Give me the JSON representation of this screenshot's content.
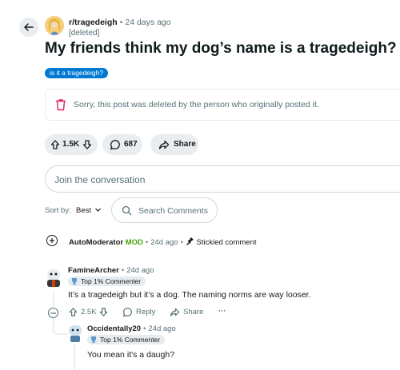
{
  "post": {
    "subreddit": "r/tragedeigh",
    "time": "24 days ago",
    "author": "[deleted]",
    "title": "My friends think my dog’s name is a tragedeigh?",
    "flair": "is it a tragedeigh?",
    "deleted_message": "Sorry, this post was deleted by the person who originally posted it."
  },
  "actions": {
    "votes": "1.5K",
    "comments": "687",
    "share": "Share"
  },
  "join_placeholder": "Join the conversation",
  "sort": {
    "label": "Sort by:",
    "value": "Best",
    "search_placeholder": "Search Comments"
  },
  "automod": {
    "name": "AutoModerator",
    "mod_badge": "MOD",
    "time": "24d ago",
    "stickied": "Stickied comment"
  },
  "comments": [
    {
      "author": "FamineArcher",
      "time": "24d ago",
      "badge": "Top 1% Commenter",
      "text": "It’s a tragedeigh but it’s a dog. The naming norms are way looser.",
      "votes": "2.5K",
      "reply": "Reply",
      "share": "Share",
      "more": "···"
    },
    {
      "author": "Occidentally20",
      "time": "24d ago",
      "badge": "Top 1% Commenter",
      "text": "You mean it's a daugh?"
    }
  ],
  "icons": {
    "back": "arrow-left-icon",
    "trash": "trash-icon",
    "upvote": "arrow-up-icon",
    "downvote": "arrow-down-icon",
    "comment": "speech-bubble-icon",
    "share": "share-arrow-icon",
    "search": "search-icon",
    "pin": "pin-icon",
    "badge": "trophy-icon"
  },
  "colors": {
    "flair": "#0079d3",
    "mod": "#46a508",
    "trash": "#e0245e",
    "pill_bg": "#e9edf0",
    "muted_text": "#576f76"
  }
}
